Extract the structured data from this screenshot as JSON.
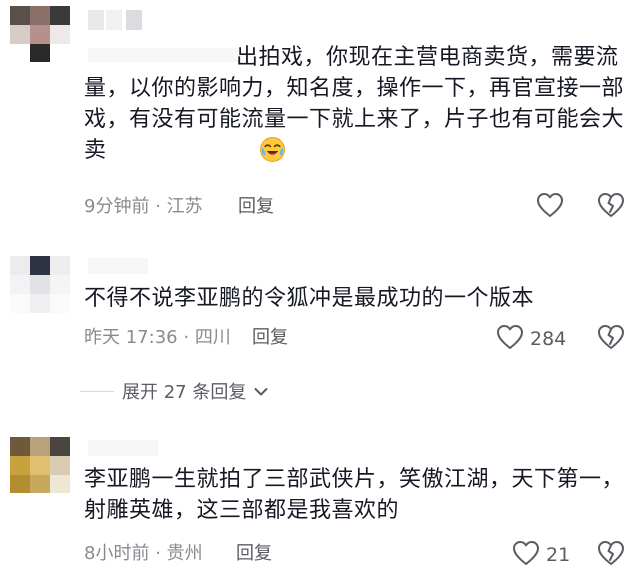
{
  "comments": [
    {
      "text": "出拍戏，你现在主营电商卖货，需要流量，以你的影响力，知名度，操作一下，再官宣接一部戏，有没有可能流量一下就上来了，片子也有可能会大卖",
      "emoji": "crying-laughing",
      "time": "9分钟前",
      "location": "江苏",
      "reply_label": "回复",
      "likes": ""
    },
    {
      "text": "不得不说李亚鹏的令狐冲是最成功的一个版本",
      "time": "昨天 17:36",
      "location": "四川",
      "reply_label": "回复",
      "likes": "284",
      "expand_label": "展开 27 条回复"
    },
    {
      "text": "李亚鹏一生就拍了三部武侠片，笑傲江湖，天下第一，射雕英雄，这三部都是我喜欢的",
      "time": "8小时前",
      "location": "贵州",
      "reply_label": "回复",
      "likes": "21"
    }
  ],
  "separator": "·",
  "colors": {
    "text": "#161823",
    "meta": "#8a8b91",
    "icon": "#5b5c63"
  }
}
